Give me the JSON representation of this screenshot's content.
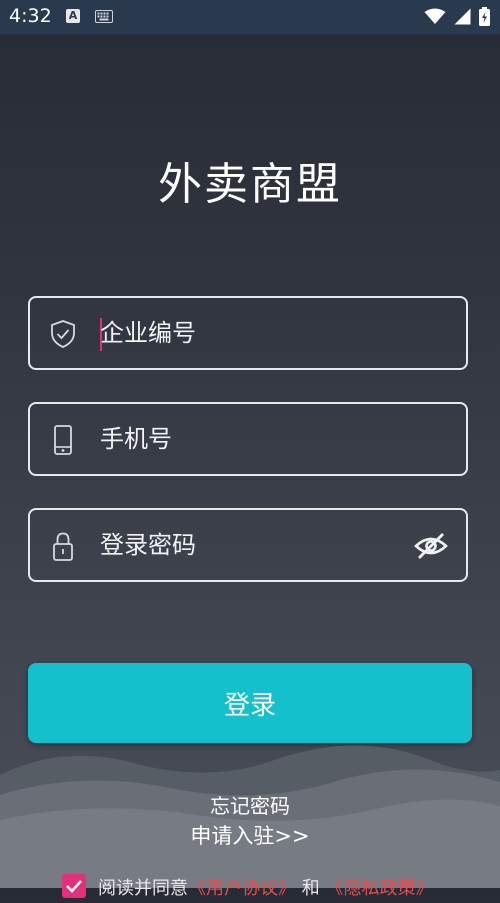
{
  "status_bar": {
    "time": "4:32",
    "a_badge": "A",
    "icons": [
      "a-notification-icon",
      "keyboard-icon",
      "wifi-icon",
      "signal-icon",
      "battery-icon"
    ]
  },
  "app": {
    "title": "外卖商盟"
  },
  "form": {
    "company_id": {
      "placeholder": "企业编号",
      "value": ""
    },
    "phone": {
      "placeholder": "手机号",
      "value": ""
    },
    "password": {
      "placeholder": "登录密码",
      "value": ""
    },
    "login_label": "登录"
  },
  "links": {
    "forgot_password": "忘记密码",
    "register": "申请入驻>>"
  },
  "agreement": {
    "prefix": "阅读并同意",
    "user_agreement": "《用户协议》",
    "conjunction": "和",
    "privacy_policy": "《隐私政策》",
    "checked": true
  },
  "colors": {
    "accent": "#14c0cc",
    "caret": "#e2307a",
    "checkbox": "#e2307a",
    "link_red": "#e24e4e"
  }
}
